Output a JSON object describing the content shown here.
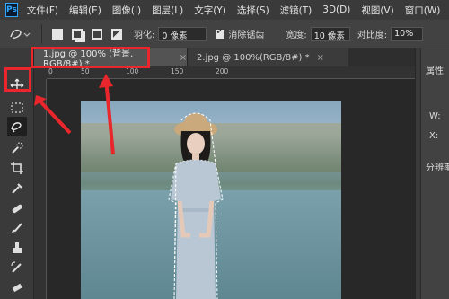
{
  "app": {
    "logo_text": "Ps"
  },
  "menu": [
    "文件(F)",
    "编辑(E)",
    "图像(I)",
    "图层(L)",
    "文字(Y)",
    "选择(S)",
    "滤镜(T)",
    "3D(D)",
    "视图(V)",
    "窗口(W)"
  ],
  "options": {
    "feather_label": "羽化:",
    "feather_value": "0 像素",
    "antialias_label": "消除锯齿",
    "width_label": "宽度:",
    "width_value": "10 像素",
    "contrast_label": "对比度:",
    "contrast_value": "10%"
  },
  "tabs": [
    {
      "label": "1.jpg @ 100% (背景, RGB/8#) *",
      "close": "×"
    },
    {
      "label": "2.jpg @ 100%(RGB/8#) *",
      "close": "×"
    }
  ],
  "ruler": {
    "h_labels": [
      "0",
      "50",
      "100",
      "150",
      "200"
    ]
  },
  "right_panel": {
    "title": "属性",
    "label_w": "W:",
    "label_x": "X:",
    "label_res": "分辨率"
  },
  "colors": {
    "highlight": "#e8262b",
    "accent": "#31a8ff"
  },
  "icons": [
    "move-icon",
    "marquee-icon",
    "magnetic-lasso-icon",
    "quick-select-icon",
    "crop-icon",
    "eyedropper-icon",
    "healing-brush-icon",
    "brush-icon",
    "stamp-icon",
    "history-brush-icon",
    "eraser-icon"
  ]
}
